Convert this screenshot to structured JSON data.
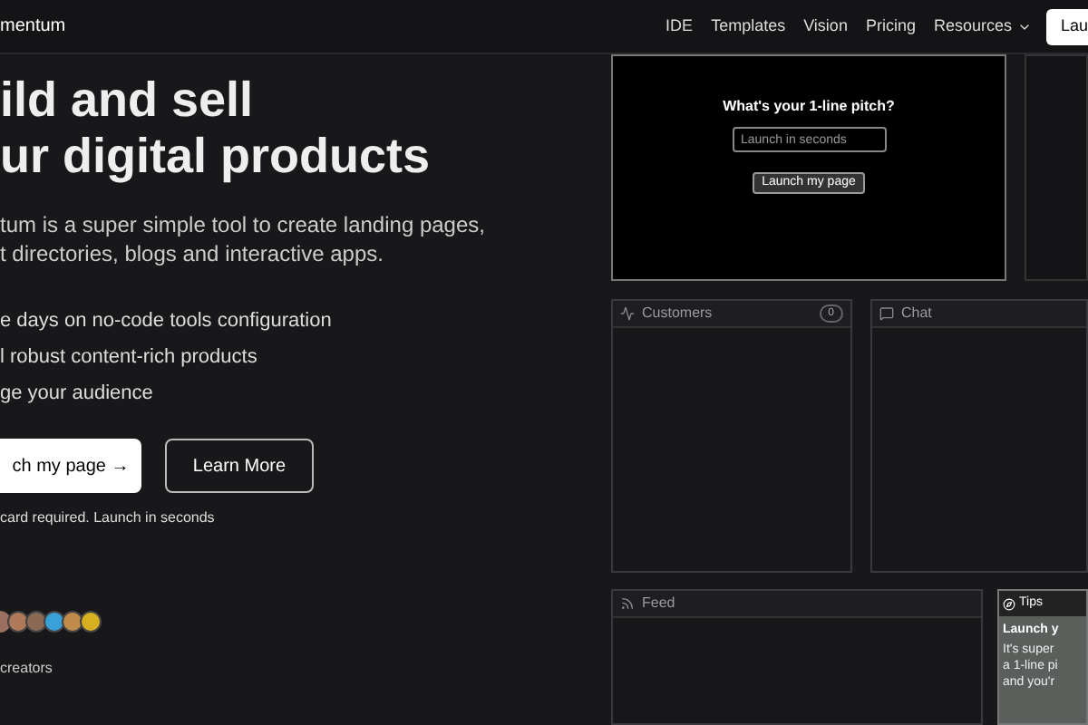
{
  "header": {
    "logo": "mentum",
    "nav": [
      {
        "label": "IDE",
        "dropdown": false
      },
      {
        "label": "Templates",
        "dropdown": false
      },
      {
        "label": "Vision",
        "dropdown": false
      },
      {
        "label": "Pricing",
        "dropdown": false
      },
      {
        "label": "Resources",
        "dropdown": true
      }
    ],
    "cta": "Lau"
  },
  "hero": {
    "title_lines": [
      "ild and sell",
      "ur digital products"
    ],
    "description": "tum is a super simple tool to create landing pages, t directories, blogs and interactive apps.",
    "bullets": [
      "e days on no-code tools configuration",
      "l robust content-rich products",
      "ge your audience"
    ],
    "primary_button": "ch my page →",
    "secondary_button": "Learn More",
    "note": "card required. Launch in seconds",
    "avatars": [
      {
        "color": "#b07a5a"
      },
      {
        "color": "#8a6a55"
      },
      {
        "color": "#3aa0d8"
      },
      {
        "color": "#c08a4a"
      },
      {
        "color": "#d6b020"
      }
    ],
    "creators": "creators"
  },
  "pitch": {
    "title": "What's your 1-line pitch?",
    "placeholder": "Launch in seconds",
    "button": "Launch my page"
  },
  "panels": [
    {
      "kind": "customers",
      "title": "Customers",
      "count": "0"
    },
    {
      "kind": "chat",
      "title": "Chat"
    },
    {
      "kind": "feed",
      "title": "Feed"
    }
  ],
  "tips": {
    "title": "Tips",
    "heading": "Launch y",
    "lines": [
      "It's super",
      "a 1-line pi",
      "and you'r"
    ]
  }
}
